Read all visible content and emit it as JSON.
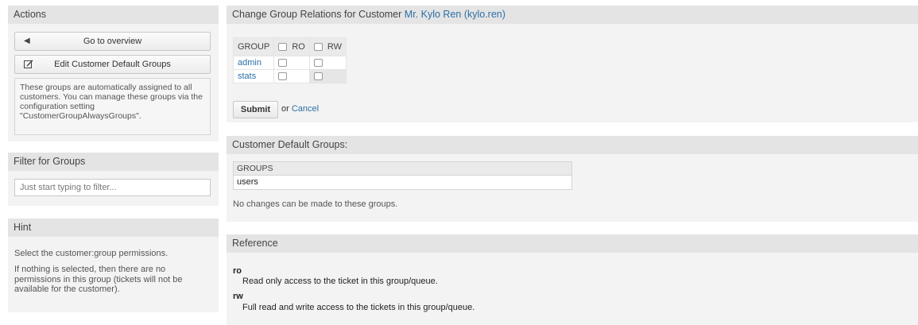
{
  "actions": {
    "header": "Actions",
    "go_overview_label": "Go to overview",
    "edit_defaults_label": "Edit Customer Default Groups",
    "note": "These groups are automatically assigned to all customers. You can manage these groups via the configuration setting \"CustomerGroupAlwaysGroups\"."
  },
  "filter": {
    "header": "Filter for Groups",
    "placeholder": "Just start typing to filter..."
  },
  "hint": {
    "header": "Hint",
    "line1": "Select the customer:group permissions.",
    "line2": "If nothing is selected, then there are no permissions in this group (tickets will not be available for the customer)."
  },
  "relations": {
    "header_prefix": "Change Group Relations for Customer",
    "customer_link": "Mr. Kylo Ren (kylo.ren)",
    "columns": [
      "GROUP",
      "RO",
      "RW"
    ],
    "rows": [
      {
        "group": "admin",
        "ro": false,
        "rw": false
      },
      {
        "group": "stats",
        "ro": false,
        "rw": false
      }
    ],
    "submit_label": "Submit",
    "or_label": "or",
    "cancel_label": "Cancel"
  },
  "default_groups": {
    "header": "Customer Default Groups:",
    "column": "GROUPS",
    "rows": [
      "users"
    ],
    "message": "No changes can be made to these groups."
  },
  "reference": {
    "header": "Reference",
    "items": [
      {
        "term": "ro",
        "desc": "Read only access to the ticket in this group/queue."
      },
      {
        "term": "rw",
        "desc": "Full read and write access to the tickets in this group/queue."
      }
    ]
  },
  "icons": {
    "back": "caret-left-icon",
    "edit": "edit-icon"
  }
}
